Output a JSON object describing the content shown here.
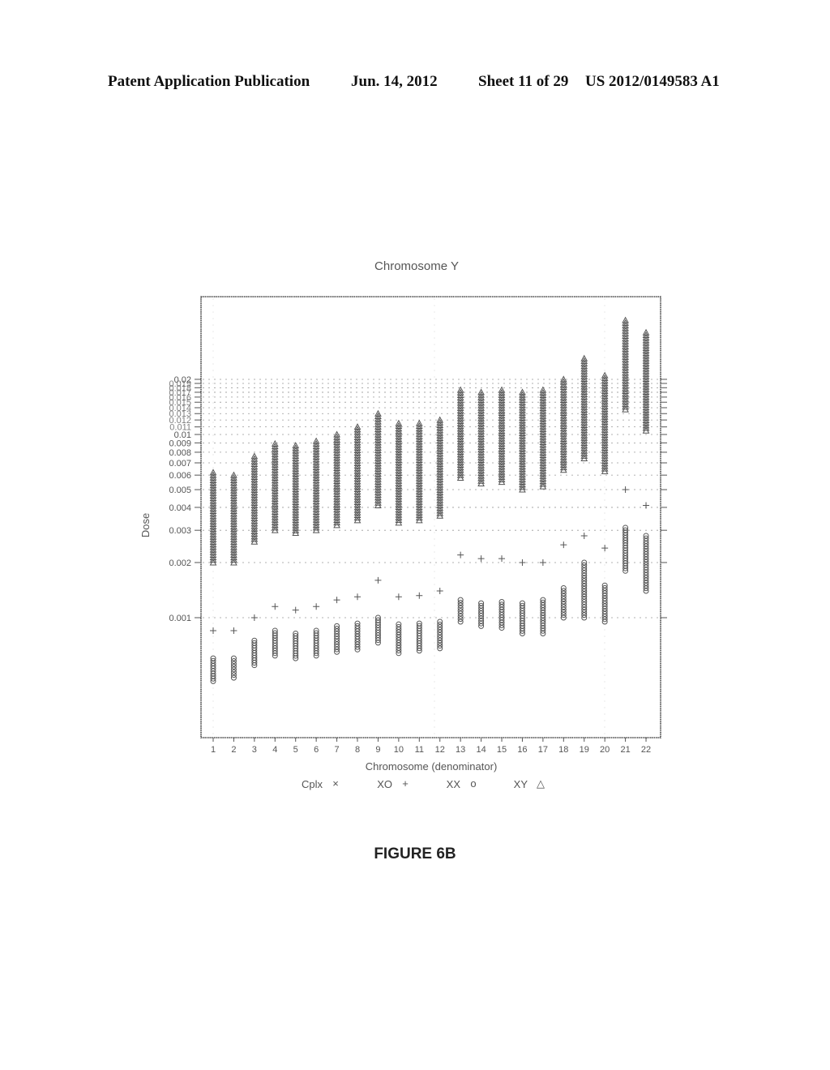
{
  "header": {
    "publication": "Patent Application Publication",
    "date": "Jun. 14, 2012",
    "sheet": "Sheet 11 of 29",
    "number": "US 2012/0149583 A1"
  },
  "figure_label": "FIGURE 6B",
  "chart_data": {
    "type": "scatter",
    "title": "Chromosome Y",
    "xlabel": "Chromosome (denominator)",
    "ylabel": "Dose",
    "y_scale": "log",
    "ylim": [
      0.00045,
      0.045
    ],
    "grid": true,
    "legend_position": "bottom",
    "categories": [
      "1",
      "2",
      "3",
      "4",
      "5",
      "6",
      "7",
      "8",
      "9",
      "10",
      "11",
      "12",
      "13",
      "14",
      "15",
      "16",
      "17",
      "18",
      "19",
      "20",
      "21",
      "22"
    ],
    "y_ticks": [
      "0.001",
      "0.002",
      "0.003",
      "0.004",
      "0.005",
      "0.006",
      "0.007",
      "0.008",
      "0.009",
      "0.01",
      "0.02"
    ],
    "y_tick_values": [
      0.001,
      0.002,
      0.003,
      0.004,
      0.005,
      0.006,
      0.007,
      0.008,
      0.009,
      0.01,
      0.011,
      0.012,
      0.013,
      0.014,
      0.015,
      0.016,
      0.017,
      0.018,
      0.019,
      0.02
    ],
    "legend": [
      {
        "name": "Cplx",
        "marker": "×"
      },
      {
        "name": "XO",
        "marker": "+"
      },
      {
        "name": "XX",
        "marker": "o"
      },
      {
        "name": "XY",
        "marker": "△"
      }
    ],
    "series": [
      {
        "name": "XO",
        "marker": "plus",
        "values": [
          0.00085,
          0.00085,
          0.001,
          0.00115,
          0.0011,
          0.00115,
          0.00125,
          0.0013,
          0.0016,
          0.0013,
          0.00132,
          0.0014,
          0.0022,
          0.0021,
          0.0021,
          0.002,
          0.002,
          0.0025,
          0.0028,
          0.0024,
          0.005,
          0.0041
        ]
      },
      {
        "name": "XX",
        "marker": "circle",
        "ranges": [
          [
            0.00045,
            0.0006
          ],
          [
            0.00047,
            0.0006
          ],
          [
            0.00055,
            0.00075
          ],
          [
            0.00062,
            0.00085
          ],
          [
            0.0006,
            0.00082
          ],
          [
            0.00062,
            0.00085
          ],
          [
            0.00065,
            0.0009
          ],
          [
            0.00067,
            0.00093
          ],
          [
            0.00073,
            0.001
          ],
          [
            0.00064,
            0.00092
          ],
          [
            0.00066,
            0.00093
          ],
          [
            0.00068,
            0.00095
          ],
          [
            0.00095,
            0.00125
          ],
          [
            0.0009,
            0.0012
          ],
          [
            0.00088,
            0.00122
          ],
          [
            0.00082,
            0.0012
          ],
          [
            0.00082,
            0.00125
          ],
          [
            0.001,
            0.00145
          ],
          [
            0.001,
            0.002
          ],
          [
            0.00095,
            0.0015
          ],
          [
            0.0018,
            0.0031
          ],
          [
            0.0014,
            0.0028
          ]
        ]
      },
      {
        "name": "XY",
        "marker": "triangle",
        "ranges": [
          [
            0.002,
            0.0062
          ],
          [
            0.002,
            0.006
          ],
          [
            0.0026,
            0.0076
          ],
          [
            0.003,
            0.0089
          ],
          [
            0.0029,
            0.0087
          ],
          [
            0.003,
            0.0092
          ],
          [
            0.0032,
            0.01
          ],
          [
            0.0034,
            0.011
          ],
          [
            0.0041,
            0.013
          ],
          [
            0.0033,
            0.0115
          ],
          [
            0.0034,
            0.0115
          ],
          [
            0.0036,
            0.012
          ],
          [
            0.0058,
            0.0175
          ],
          [
            0.0054,
            0.017
          ],
          [
            0.0055,
            0.0175
          ],
          [
            0.005,
            0.017
          ],
          [
            0.0052,
            0.0175
          ],
          [
            0.0064,
            0.02
          ],
          [
            0.0074,
            0.026
          ],
          [
            0.0063,
            0.021
          ],
          [
            0.0137,
            0.042
          ],
          [
            0.0105,
            0.036
          ]
        ]
      }
    ]
  }
}
